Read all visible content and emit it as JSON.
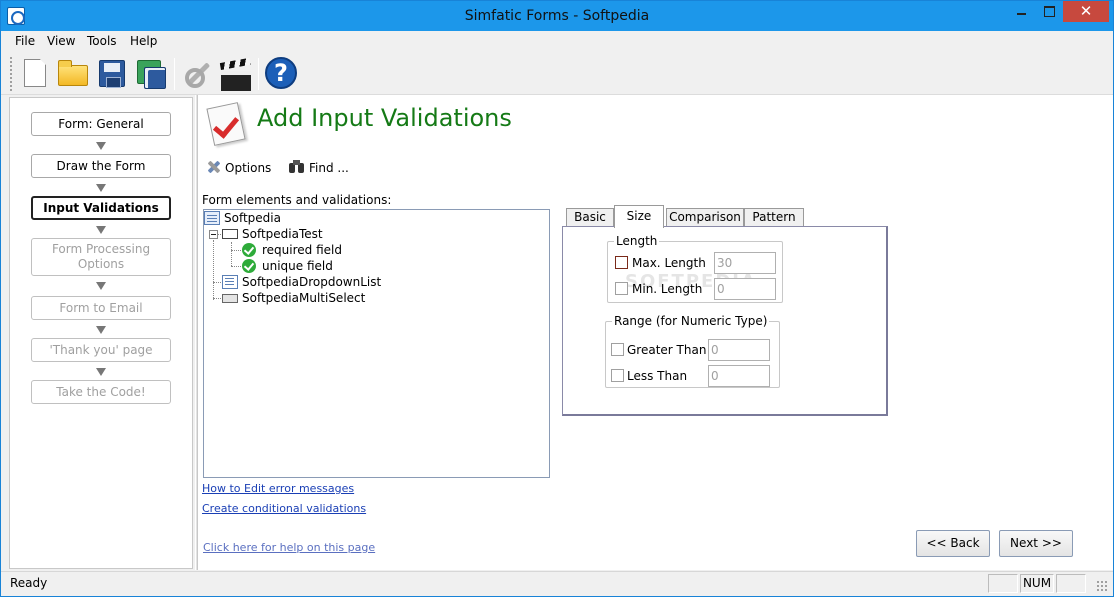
{
  "window": {
    "title": "Simfatic Forms - Softpedia",
    "close_glyph": "✕"
  },
  "menu": [
    "File",
    "View",
    "Tools",
    "Help"
  ],
  "toolbar": {
    "buttons": [
      "new-icon",
      "open-icon",
      "save-icon",
      "save-as-icon",
      "tools-icon",
      "clapperboard-icon",
      "help-icon"
    ],
    "help_glyph": "?"
  },
  "wizard": {
    "steps": [
      {
        "label": "Form: General",
        "state": "enabled"
      },
      {
        "label": "Draw the Form",
        "state": "enabled"
      },
      {
        "label": "Input Validations",
        "state": "current"
      },
      {
        "label": "Form Processing\nOptions",
        "state": "disabled"
      },
      {
        "label": "Form to Email",
        "state": "disabled"
      },
      {
        "label": "'Thank you' page",
        "state": "disabled"
      },
      {
        "label": "Take the Code!",
        "state": "disabled"
      }
    ]
  },
  "page": {
    "title": "Add Input Validations",
    "options_label": "Options",
    "find_label": "Find ...",
    "tree_label": "Form elements and validations:"
  },
  "tree": {
    "root": "Softpedia",
    "field": "SoftpediaTest",
    "validations": [
      "required field",
      "unique field"
    ],
    "dropdown": "SoftpediaDropdownList",
    "multiselect": "SoftpediaMultiSelect"
  },
  "links": {
    "edit_errors": "How to Edit error messages",
    "conditional": "Create conditional validations",
    "help": "Click here for help on this page"
  },
  "tabs": [
    "Basic",
    "Size",
    "Comparison",
    "Pattern"
  ],
  "active_tab": "Size",
  "size_tab": {
    "length_group": "Length",
    "max_length_label": "Max. Length",
    "max_length_value": "30",
    "min_length_label": "Min. Length",
    "min_length_value": "0",
    "range_group": "Range (for Numeric Type)",
    "greater_than_label": "Greater Than",
    "greater_than_value": "0",
    "less_than_label": "Less Than",
    "less_than_value": "0"
  },
  "watermark": "SOFTPEDIA",
  "nav": {
    "back": "<< Back",
    "next": "Next >>"
  },
  "status": {
    "text": "Ready",
    "num": "NUM"
  }
}
